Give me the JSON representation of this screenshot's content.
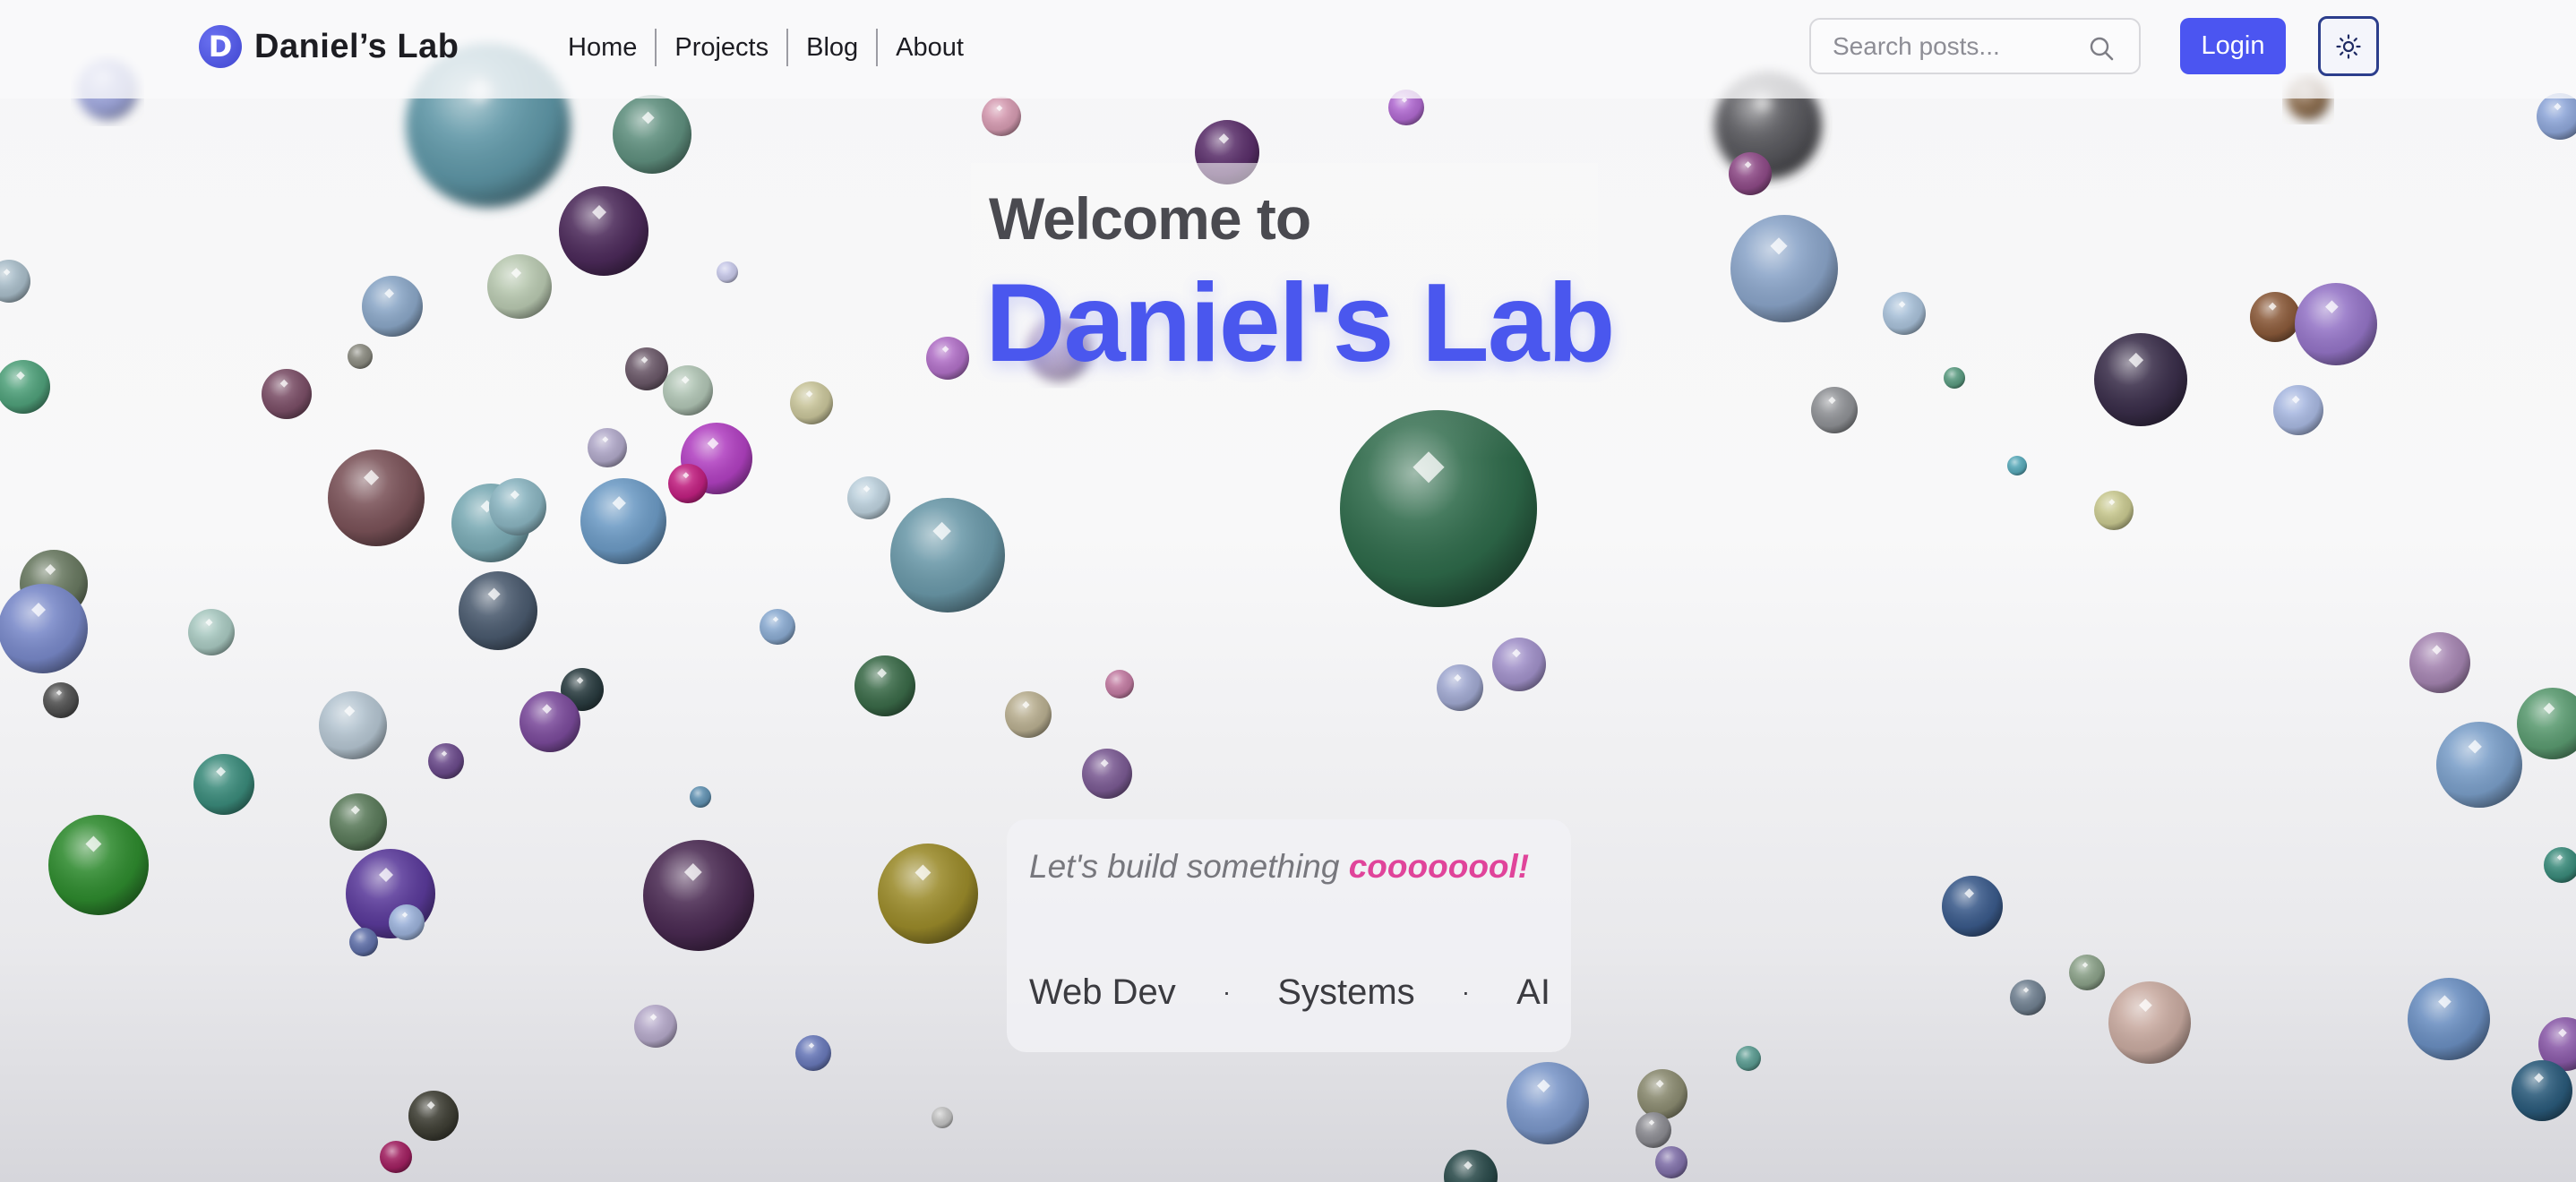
{
  "brand": {
    "initial": "D",
    "name": "Daniel’s Lab"
  },
  "nav": {
    "items": [
      "Home",
      "Projects",
      "Blog",
      "About"
    ]
  },
  "search": {
    "placeholder": "Search posts..."
  },
  "actions": {
    "login_label": "Login"
  },
  "hero": {
    "welcome": "Welcome to",
    "title": "Daniel's Lab",
    "tagline_prefix": "Let's build something ",
    "tagline_accent": "coooooool!",
    "skills": [
      "Web Dev",
      "Systems",
      "AI"
    ],
    "separator": "·"
  },
  "icons": {
    "search": "search-icon",
    "theme": "sun-icon"
  },
  "colors": {
    "accent": "#4b55f1",
    "title": "#4a57ee",
    "highlight": "#e0449a"
  }
}
